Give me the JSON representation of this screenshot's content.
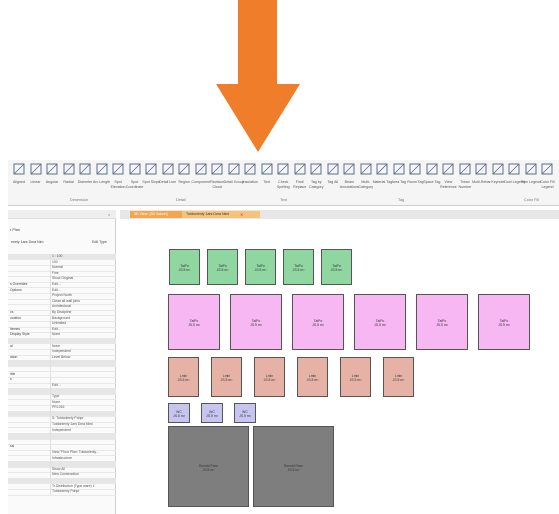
{
  "ribbon": {
    "buttons": [
      "Aligned",
      "Linear",
      "Angular",
      "Radial",
      "Diameter",
      "Arc Length",
      "Spot Elevation",
      "Spot Coordinate",
      "Spot Slope",
      "Detail Line",
      "Region",
      "Component",
      "Revision Cloud",
      "Detail Group",
      "Insulation",
      "Text",
      "Check Spelling",
      "Find/ Replace",
      "Tag by Category",
      "Tag All",
      "Beam Annotations",
      "Multi-Category",
      "Material Tag",
      "Area Tag",
      "Room Tag",
      "Space Tag",
      "View Reference",
      "Tread Number",
      "Multi-Rebar",
      "Keynote",
      "Duct Legend",
      "Pipe Legend",
      "Color Fill Legend"
    ],
    "panels": [
      "Dimension",
      "Detail",
      "Text",
      "Tag",
      "Color Fill"
    ]
  },
  "tabs": [
    {
      "label": "3D View: {3D Sabon}"
    },
    {
      "label": "Tutdonlenly 1ars Dma Nimi"
    }
  ],
  "properties": {
    "title": "r Plan",
    "type_selector": "enely 1ars Dma Nim",
    "edit_type": "Edit Type",
    "rows": [
      {
        "label": "",
        "value": "1 : 100",
        "head": true
      },
      {
        "label": "",
        "value": "100"
      },
      {
        "label": "",
        "value": "Normal"
      },
      {
        "label": "",
        "value": "Fine"
      },
      {
        "label": "",
        "value": "Show Original"
      },
      {
        "label": "s Overrides",
        "value": "Edit..."
      },
      {
        "label": "Options",
        "value": "Edit..."
      },
      {
        "label": "",
        "value": "Project North"
      },
      {
        "label": "",
        "value": "Clean all wall joins"
      },
      {
        "label": "",
        "value": "Architectural"
      },
      {
        "label": "cs",
        "value": "By Discipline"
      },
      {
        "label": "ocation",
        "value": "Background"
      },
      {
        "label": "",
        "value": "Unlimited"
      },
      {
        "label": "itemes",
        "value": "Edit..."
      },
      {
        "label": "Display Style",
        "value": "None"
      },
      {
        "label": "",
        "value": "",
        "head": true
      },
      {
        "label": "al",
        "value": "None"
      },
      {
        "label": "",
        "value": "Independent"
      },
      {
        "label": "ation",
        "value": "Level Below"
      },
      {
        "label": "",
        "value": "",
        "head": true
      },
      {
        "label": "",
        "value": ""
      },
      {
        "label": "ible",
        "value": ""
      },
      {
        "label": "s",
        "value": ""
      },
      {
        "label": "",
        "value": "Edit..."
      },
      {
        "label": "",
        "value": "",
        "head": true
      },
      {
        "label": "",
        "value": "Type"
      },
      {
        "label": "",
        "value": "None"
      },
      {
        "label": "",
        "value": "PRI-016"
      },
      {
        "label": "",
        "value": "",
        "head": true
      },
      {
        "label": "",
        "value": "S: Tutdonlenly Pohpr"
      },
      {
        "label": "",
        "value": "Tutdonlenly 1ars Dma Nimi"
      },
      {
        "label": "",
        "value": "Independent"
      },
      {
        "label": "",
        "value": "",
        "head": true
      },
      {
        "label": "",
        "value": ""
      },
      {
        "label": "ssi",
        "value": ""
      },
      {
        "label": "",
        "value": "View \"Floor Plan: Tutdonlenly..."
      },
      {
        "label": "",
        "value": "Infrastructure"
      },
      {
        "label": "",
        "value": "",
        "head": true
      },
      {
        "label": "",
        "value": "Show All"
      },
      {
        "label": "",
        "value": "New Construction"
      },
      {
        "label": "",
        "value": "",
        "head": true
      },
      {
        "label": "",
        "value": "Tr.Distribution (Type ware) 1"
      },
      {
        "label": "",
        "value": "Tutdonlenly Pohpr"
      }
    ]
  },
  "rooms": {
    "green": [
      {
        "name": "TaiPo",
        "area": "JS.5 m²"
      },
      {
        "name": "TaiPo",
        "area": "JS.5 m²"
      },
      {
        "name": "TaiPo",
        "area": "JS.5 m²"
      },
      {
        "name": "TaiPo",
        "area": "JS.5 m²"
      },
      {
        "name": "TaiPo",
        "area": "JS.5 m²"
      }
    ],
    "pink": [
      {
        "name": "TaiPo",
        "area": "JS.5 m²"
      },
      {
        "name": "TaiPo",
        "area": "JS.5 m²"
      },
      {
        "name": "TaiPo",
        "area": "JS.5 m²"
      },
      {
        "name": "TaiPo",
        "area": "JS.5 m²"
      },
      {
        "name": "TaiPo",
        "area": "JS.5 m²"
      },
      {
        "name": "TaiPo",
        "area": "JS.5 m²"
      }
    ],
    "salmon": [
      {
        "name": "Lmln",
        "area": "JS.5 m²"
      },
      {
        "name": "Lmln",
        "area": "JS.5 m²"
      },
      {
        "name": "Lmln",
        "area": "JS.5 m²"
      },
      {
        "name": "Lmln",
        "area": "JS.5 m²"
      },
      {
        "name": "Lmln",
        "area": "JS.5 m²"
      },
      {
        "name": "Lmln",
        "area": "JS.5 m²"
      }
    ],
    "blue": [
      {
        "name": "WC",
        "area": "JS.5 m²"
      },
      {
        "name": "WC",
        "area": "JS.5 m²"
      },
      {
        "name": "WC",
        "area": "JS.5 m²"
      }
    ],
    "grey": [
      {
        "name": "Rovnbl Pavc",
        "area": "JS.5 m²"
      },
      {
        "name": "Rovnbl Pavc",
        "area": "JS.5 m²"
      }
    ]
  },
  "colors": {
    "arrow": "#f07d2a",
    "green": "#8fd6a1",
    "pink": "#f7b7f2",
    "salmon": "#e7b2a6",
    "blue": "#c7c5f0",
    "grey": "#7e7e7e"
  }
}
